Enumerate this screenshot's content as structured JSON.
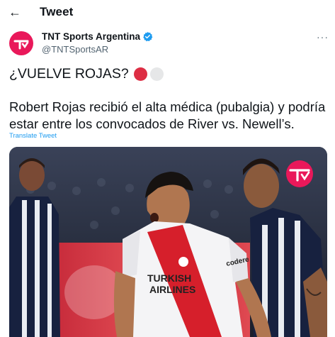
{
  "header": {
    "back_icon": "arrow-left-icon",
    "title": "Tweet"
  },
  "author": {
    "display_name": "TNT Sports Argentina",
    "handle": "@TNTSportsAR",
    "verified_icon": "verified-badge-icon",
    "avatar_icon": "tnt-sports-logo-icon",
    "brand_color": "#e9185a",
    "verified_color": "#1d9bf0"
  },
  "more_icon": "more-dots-icon",
  "tweet": {
    "headline": "¿VUELVE ROJAS?",
    "emoji": [
      "red-circle",
      "white-circle"
    ],
    "body": "Robert Rojas recibió el alta médica (pubalgia) y podría estar entre los convocados de River vs. Newell’s.",
    "translate_label": "Translate Tweet"
  },
  "media": {
    "shirt_text": [
      "TURKISH",
      "AIRLINES"
    ],
    "sleeve_text": "codere",
    "watermark_icon": "tnt-sports-logo-icon",
    "colors": {
      "river_red": "#d61f2b",
      "alianza_navy": "#17213f"
    }
  }
}
